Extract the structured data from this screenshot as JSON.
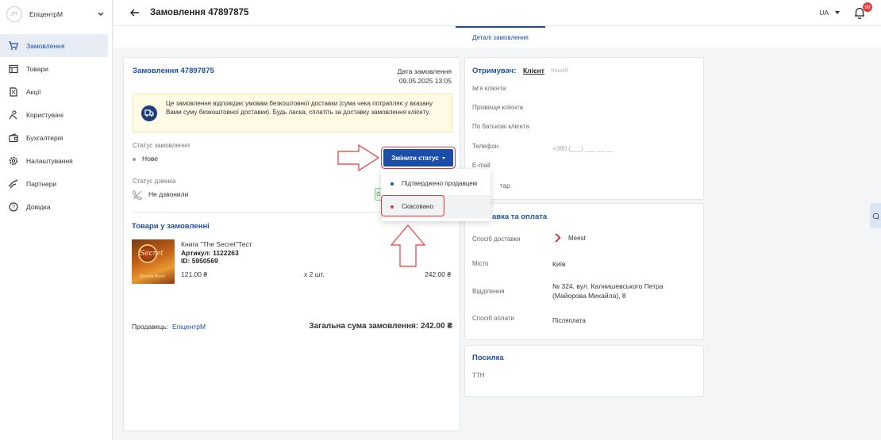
{
  "sidebar": {
    "brand_avatar": "ЛТ",
    "brand_name": "ЕпіцентрМ",
    "items": [
      {
        "label": "Замовлення",
        "icon": "cart-icon"
      },
      {
        "label": "Товари",
        "icon": "store-icon"
      },
      {
        "label": "Акції",
        "icon": "promo-icon"
      },
      {
        "label": "Користувачі",
        "icon": "users-icon"
      },
      {
        "label": "Бухгалтерія",
        "icon": "wallet-icon"
      },
      {
        "label": "Налаштування",
        "icon": "gear-icon"
      },
      {
        "label": "Партнери",
        "icon": "handshake-icon"
      },
      {
        "label": "Довідка",
        "icon": "help-icon"
      }
    ]
  },
  "header": {
    "title": "Замовлення 47897875",
    "lang": "UA",
    "notifications": "99"
  },
  "tabs": {
    "details": "Деталі замовлення"
  },
  "order": {
    "title": "Замовлення 47897875",
    "date_label": "Дата замовлення",
    "date_value": "09.05.2025 13:05",
    "notice": "Це замовлення відповідає умовам безкоштовної доставки (сума чека потрапляє у вказану Вами суму безкоштовної доставки). Будь ласка, сплатіть за доставку замовлення клієнту.",
    "status_label": "Статус замовлення",
    "status_value": "Нове",
    "change_status": "Змінити статус",
    "call_label": "Статус дзвінка",
    "call_value": "Не дзвонили",
    "dropdown": [
      "Підтверджено продавцем",
      "Скасовано"
    ],
    "goods_title": "Товари у замовленні",
    "item": {
      "name": "Книга \"The Secret\"Тест",
      "sku": "Артикул: 1122263",
      "id": "ID: 5950569",
      "price": "121.00 ₴",
      "qty": "x 2 шт.",
      "total": "242.00 ₴",
      "cover_word": "Secret",
      "cover_author": "Rhonda Byrne"
    },
    "seller_label": "Продавець:",
    "seller_name": "ЕпіцентрМ",
    "sum": "Загальна сума замовлення: 242.00 ₴"
  },
  "recipient": {
    "title": "Отримувач:",
    "tab_client": "Клієнт",
    "tab_other": "Інший",
    "first_name": "Ім'я клієнта",
    "last_name": "Прізвище клієнта",
    "middle_name": "По батькові клієнта",
    "phone_label": "Телефон",
    "phone_placeholder": "+380 (___) ___ __ __",
    "email_label": "E-mail",
    "comment_label": "тар"
  },
  "delivery": {
    "title": "авка та оплата",
    "method_label": "Спосіб доставки",
    "method_value": "Meest",
    "city_label": "Місто",
    "city_value": "Київ",
    "branch_label": "Відділення",
    "branch_value_1": "№ 324, вул. Калнишевського Петра",
    "branch_value_2": "(Майорова Михайла), 8",
    "payment_label": "Спосіб оплати",
    "payment_value": "Післяплата"
  },
  "parcel": {
    "title": "Посилка",
    "ttn": "ТТН"
  },
  "colors": {
    "accent": "#1d4ea7",
    "highlight": "#e53935"
  }
}
